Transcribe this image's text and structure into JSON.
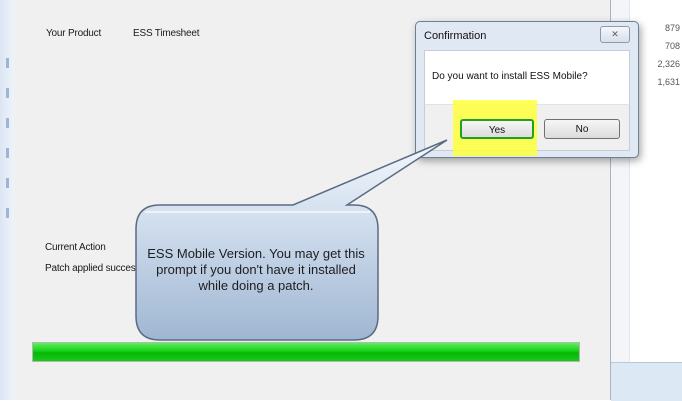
{
  "installer": {
    "product_label": "Your Product",
    "product_value": "ESS Timesheet",
    "current_action_label": "Current Action",
    "status_text": "Patch applied successfully!",
    "progress": 1.0
  },
  "dialog": {
    "title": "Confirmation",
    "close_icon": "close-icon",
    "message": "Do you want to install ESS Mobile?",
    "yes_label": "Yes",
    "no_label": "No"
  },
  "callout": {
    "text": "ESS Mobile Version. You may get this prompt if you don't have it installed while doing a patch."
  },
  "background_numbers": [
    "879",
    "708",
    "2,326",
    "1,631"
  ],
  "colors": {
    "progress_green": "#17d017",
    "highlight_yellow": "#ffff3c",
    "yes_border": "#21a021"
  }
}
